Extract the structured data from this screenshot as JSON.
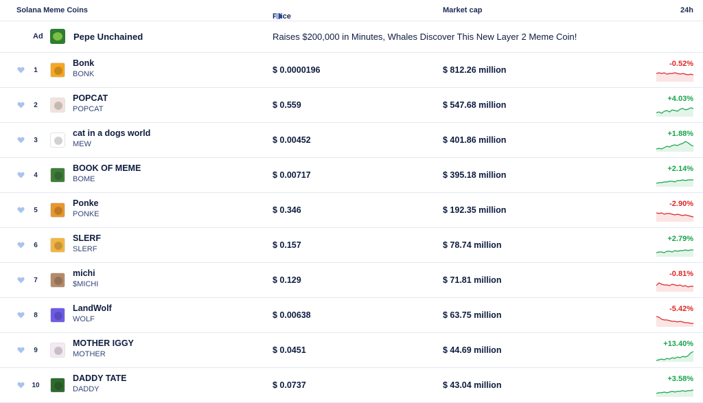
{
  "header": {
    "name_col": "Solana Meme Coins",
    "price_col": "Price",
    "cap_col": "Market cap",
    "change_col": "24h"
  },
  "ad": {
    "label": "Ad",
    "name": "Pepe Unchained",
    "text": "Raises $200,000 in Minutes, Whales Discover This New Layer 2 Meme Coin!"
  },
  "colors": {
    "up": "#16a34a",
    "down": "#dc2626",
    "heart": "#a9c3ef"
  },
  "coins": [
    {
      "rank": "1",
      "name": "Bonk",
      "symbol": "BONK",
      "price": "$ 0.0000196",
      "cap": "$ 812.26 million",
      "change": "-0.52%",
      "dir": "down",
      "logo": "#f6a623",
      "spark": [
        6,
        5,
        6,
        5,
        7,
        6,
        6,
        5,
        6,
        7,
        6,
        7,
        8,
        7,
        8
      ]
    },
    {
      "rank": "2",
      "name": "POPCAT",
      "symbol": "POPCAT",
      "price": "$ 0.559",
      "cap": "$ 547.68 million",
      "change": "+4.03%",
      "dir": "up",
      "logo": "#f1e2dc",
      "spark": [
        12,
        11,
        13,
        10,
        9,
        11,
        8,
        9,
        10,
        7,
        6,
        8,
        7,
        5,
        6
      ]
    },
    {
      "rank": "3",
      "name": "cat in a dogs world",
      "symbol": "MEW",
      "price": "$ 0.00452",
      "cap": "$ 401.86 million",
      "change": "+1.88%",
      "dir": "up",
      "logo": "#ffffff",
      "spark": [
        14,
        13,
        14,
        12,
        10,
        11,
        9,
        8,
        9,
        7,
        6,
        3,
        5,
        8,
        10
      ]
    },
    {
      "rank": "4",
      "name": "BOOK OF MEME",
      "symbol": "BOME",
      "price": "$ 0.00717",
      "cap": "$ 395.18 million",
      "change": "+2.14%",
      "dir": "up",
      "logo": "#3f7d3a",
      "spark": [
        13,
        12,
        12,
        11,
        11,
        10,
        10,
        11,
        9,
        9,
        8,
        9,
        8,
        8,
        8
      ]
    },
    {
      "rank": "5",
      "name": "Ponke",
      "symbol": "PONKE",
      "price": "$ 0.346",
      "cap": "$ 192.35 million",
      "change": "-2.90%",
      "dir": "down",
      "logo": "#e8962e",
      "spark": [
        5,
        6,
        5,
        7,
        6,
        6,
        7,
        8,
        7,
        8,
        9,
        8,
        9,
        10,
        11
      ]
    },
    {
      "rank": "6",
      "name": "SLERF",
      "symbol": "SLERF",
      "price": "$ 0.157",
      "cap": "$ 78.74 million",
      "change": "+2.79%",
      "dir": "up",
      "logo": "#f2b544",
      "spark": [
        12,
        11,
        11,
        12,
        10,
        10,
        11,
        9,
        10,
        9,
        9,
        8,
        9,
        8,
        8
      ]
    },
    {
      "rank": "7",
      "name": "michi",
      "symbol": "$MICHI",
      "price": "$ 0.129",
      "cap": "$ 71.81 million",
      "change": "-0.81%",
      "dir": "down",
      "logo": "#b48a6a",
      "spark": [
        9,
        5,
        7,
        8,
        8,
        9,
        7,
        8,
        9,
        8,
        10,
        9,
        11,
        10,
        10
      ]
    },
    {
      "rank": "8",
      "name": "LandWolf",
      "symbol": "WOLF",
      "price": "$ 0.00638",
      "cap": "$ 63.75 million",
      "change": "-5.42%",
      "dir": "down",
      "logo": "#6c5ce7",
      "spark": [
        3,
        4,
        7,
        8,
        8,
        9,
        10,
        10,
        11,
        10,
        11,
        12,
        12,
        13,
        13
      ]
    },
    {
      "rank": "9",
      "name": "MOTHER IGGY",
      "symbol": "MOTHER",
      "price": "$ 0.0451",
      "cap": "$ 44.69 million",
      "change": "+13.40%",
      "dir": "up",
      "logo": "#f4e9f2",
      "spark": [
        16,
        15,
        14,
        15,
        13,
        14,
        12,
        13,
        11,
        12,
        10,
        11,
        9,
        5,
        3
      ]
    },
    {
      "rank": "10",
      "name": "DADDY TATE",
      "symbol": "DADDY",
      "price": "$ 0.0737",
      "cap": "$ 43.04 million",
      "change": "+3.58%",
      "dir": "up",
      "logo": "#2f6b2f",
      "spark": [
        13,
        12,
        12,
        11,
        12,
        11,
        10,
        11,
        10,
        10,
        9,
        10,
        9,
        9,
        8
      ]
    }
  ]
}
